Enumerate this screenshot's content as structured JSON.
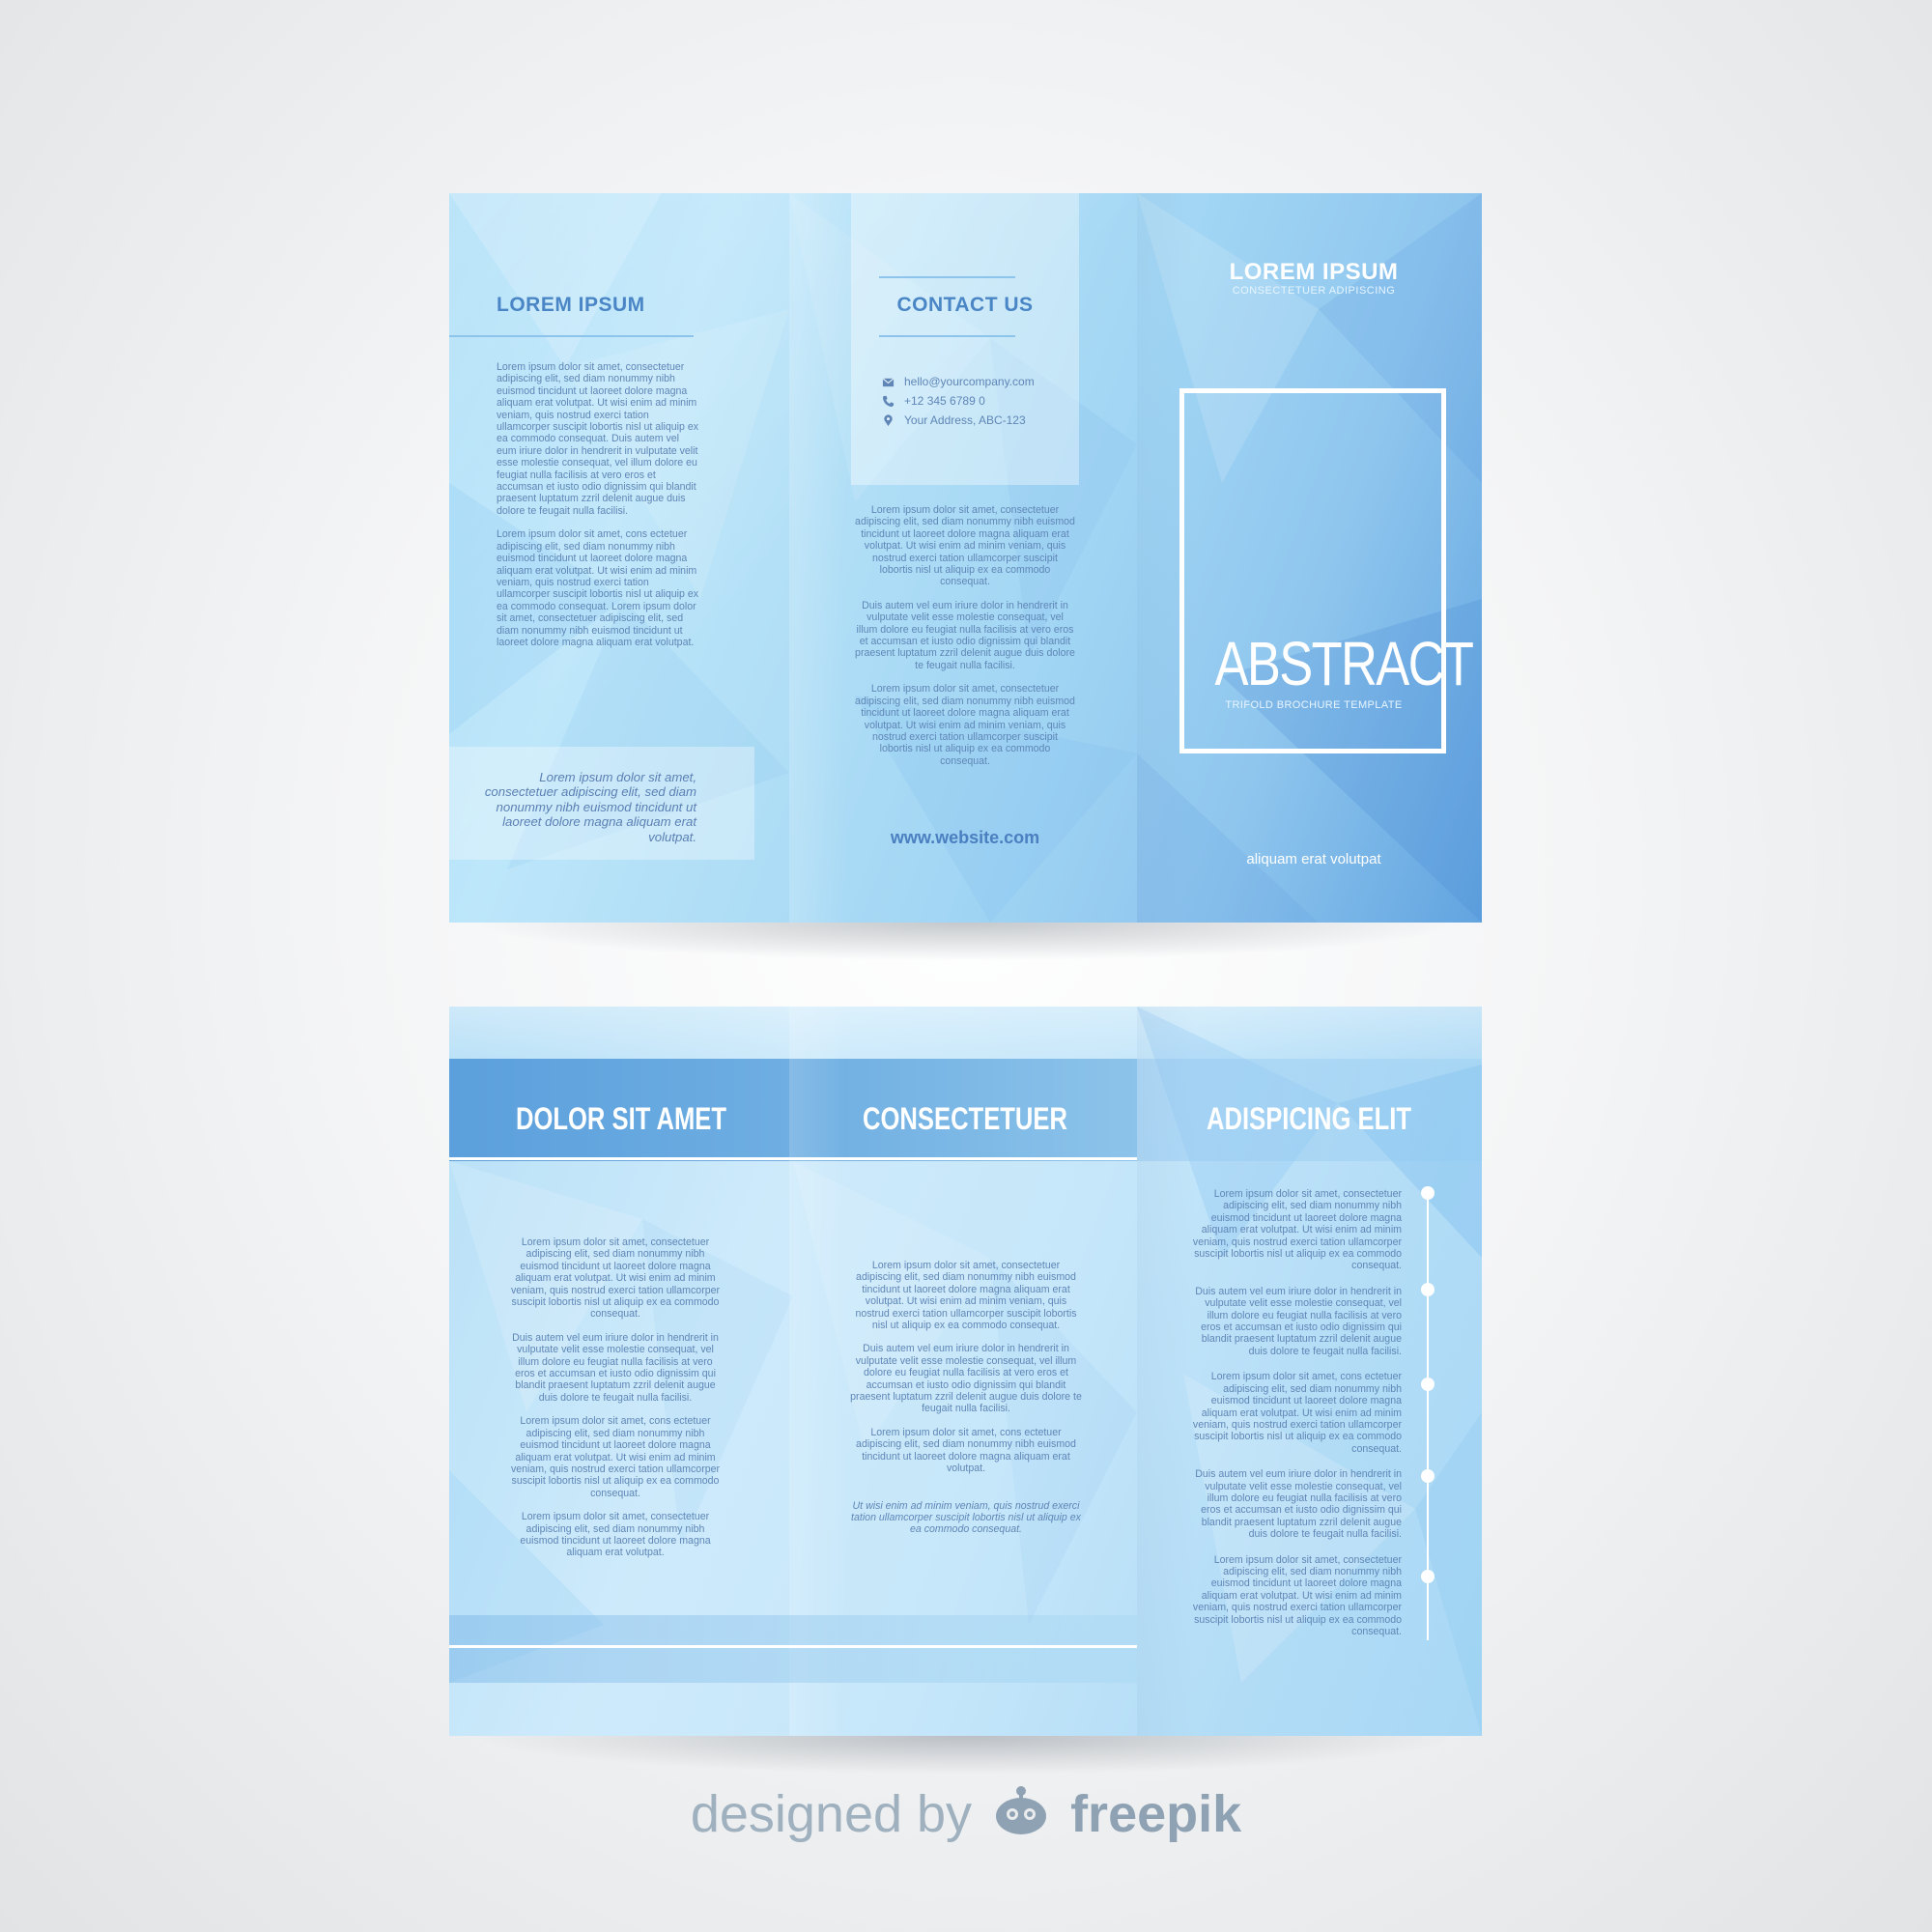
{
  "outer": {
    "left_panel": {
      "heading": "LOREM IPSUM",
      "paragraphs": [
        "Lorem ipsum dolor sit amet, consectetuer adipiscing elit, sed diam nonummy nibh euismod tincidunt ut laoreet dolore magna aliquam erat volutpat. Ut wisi enim ad minim veniam, quis nostrud exerci tation ullamcorper suscipit lobortis nisl ut aliquip ex ea commodo consequat. Duis autem vel eum iriure dolor in hendrerit in vulputate velit esse molestie consequat, vel illum dolore eu feugiat nulla facilisis at vero eros et accumsan et iusto odio dignissim qui blandit praesent luptatum zzril delenit augue duis dolore te feugait nulla facilisi.",
        "Lorem ipsum dolor sit amet, cons ectetuer adipiscing elit, sed diam nonummy nibh euismod tincidunt ut laoreet dolore magna aliquam erat volutpat. Ut wisi enim ad minim veniam, quis nostrud exerci tation ullamcorper suscipit lobortis nisl ut aliquip ex ea commodo consequat. Lorem ipsum dolor sit amet, consectetuer adipiscing elit, sed diam nonummy nibh euismod tincidunt ut laoreet dolore magna aliquam erat volutpat."
      ],
      "quote": "Lorem ipsum dolor sit amet, consectetuer adipiscing elit, sed diam nonummy nibh euismod tincidunt ut laoreet dolore magna aliquam erat volutpat."
    },
    "middle_panel": {
      "heading": "CONTACT US",
      "email": "hello@yourcompany.com",
      "phone": "+12 345 6789 0",
      "address": "Your Address, ABC-123",
      "paragraphs": [
        "Lorem ipsum dolor sit amet, consectetuer adipiscing elit, sed diam nonummy nibh euismod tincidunt ut laoreet dolore magna aliquam erat volutpat. Ut wisi enim ad minim veniam, quis nostrud exerci tation ullamcorper suscipit lobortis nisl ut aliquip ex ea commodo consequat.",
        "Duis autem vel eum iriure dolor in hendrerit in vulputate velit esse molestie consequat, vel illum dolore eu feugiat nulla facilisis at vero eros et accumsan et iusto odio dignissim qui blandit praesent luptatum zzril delenit augue duis dolore te feugait nulla facilisi.",
        "Lorem ipsum dolor sit amet, consectetuer adipiscing elit, sed diam nonummy nibh euismod tincidunt ut laoreet dolore magna aliquam erat volutpat. Ut wisi enim ad minim veniam, quis nostrud exerci tation ullamcorper suscipit lobortis nisl ut aliquip ex ea commodo consequat."
      ],
      "website": "www.website.com"
    },
    "cover_panel": {
      "title": "LOREM IPSUM",
      "subtitle": "CONSECTETUER ADIPISCING",
      "main_title": "ABSTRACT",
      "main_subtitle": "TRIFOLD BROCHURE TEMPLATE",
      "footer": "aliquam erat volutpat"
    }
  },
  "inner": {
    "headings": [
      "DOLOR SIT AMET",
      "CONSECTETUER",
      "ADISPICING ELIT"
    ],
    "col1": [
      "Lorem ipsum dolor sit amet, consectetuer adipiscing elit, sed diam nonummy nibh euismod tincidunt ut laoreet dolore magna aliquam erat volutpat. Ut wisi enim ad minim veniam, quis nostrud exerci tation ullamcorper suscipit lobortis nisl ut aliquip ex ea commodo consequat.",
      "Duis autem vel eum iriure dolor in hendrerit in vulputate velit esse molestie consequat, vel illum dolore eu feugiat nulla facilisis at vero eros et accumsan et iusto odio dignissim qui blandit praesent luptatum zzril delenit augue duis dolore te feugait nulla facilisi.",
      "Lorem ipsum dolor sit amet, cons ectetuer adipiscing elit, sed diam nonummy nibh euismod tincidunt ut laoreet dolore magna aliquam erat volutpat. Ut wisi enim ad minim veniam, quis nostrud exerci tation ullamcorper suscipit lobortis nisl ut aliquip ex ea commodo consequat.",
      "Lorem ipsum dolor sit amet, consectetuer adipiscing elit, sed diam nonummy nibh euismod tincidunt ut laoreet dolore magna aliquam erat volutpat."
    ],
    "col2": [
      "Lorem ipsum dolor sit amet, consectetuer adipiscing elit, sed diam nonummy nibh euismod tincidunt ut laoreet dolore magna aliquam erat volutpat. Ut wisi enim ad minim veniam, quis nostrud exerci tation ullamcorper suscipit lobortis nisl ut aliquip ex ea commodo consequat.",
      "Duis autem vel eum iriure dolor in hendrerit in vulputate velit esse molestie consequat, vel illum dolore eu feugiat nulla facilisis at vero eros et accumsan et iusto odio dignissim qui blandit praesent luptatum zzril delenit augue duis dolore te feugait nulla facilisi.",
      "Lorem ipsum dolor sit amet, cons ectetuer adipiscing elit, sed diam nonummy nibh euismod tincidunt ut laoreet dolore magna aliquam erat volutpat."
    ],
    "col2_italic": "Ut wisi enim ad minim veniam, quis nostrud exerci tation ullamcorper suscipit lobortis nisl ut aliquip ex ea commodo consequat.",
    "col3": [
      "Lorem ipsum dolor sit amet, consectetuer adipiscing elit, sed diam nonummy nibh euismod tincidunt ut laoreet dolore magna aliquam erat volutpat. Ut wisi enim ad minim veniam, quis nostrud exerci tation ullamcorper suscipit lobortis nisl ut aliquip ex ea commodo consequat.",
      "Duis autem vel eum iriure dolor in hendrerit in vulputate velit esse molestie consequat, vel illum dolore eu feugiat nulla facilisis at vero eros et accumsan et iusto odio dignissim qui blandit praesent luptatum zzril delenit augue duis dolore te feugait nulla facilisi.",
      "Lorem ipsum dolor sit amet, cons ectetuer adipiscing elit, sed diam nonummy nibh euismod tincidunt ut laoreet dolore magna aliquam erat volutpat. Ut wisi enim ad minim veniam, quis nostrud exerci tation ullamcorper suscipit lobortis nisl ut aliquip ex ea commodo consequat.",
      "Duis autem vel eum iriure dolor in hendrerit in vulputate velit esse molestie consequat, vel illum dolore eu feugiat nulla facilisis at vero eros et accumsan et iusto odio dignissim qui blandit praesent luptatum zzril delenit augue duis dolore te feugait nulla facilisi.",
      "Lorem ipsum dolor sit amet, consectetuer adipiscing elit, sed diam nonummy nibh euismod tincidunt ut laoreet dolore magna aliquam erat volutpat. Ut wisi enim ad minim veniam, quis nostrud exerci tation ullamcorper suscipit lobortis nisl ut aliquip ex ea commodo consequat."
    ]
  },
  "credit": {
    "prefix": "designed by",
    "brand": "freepik"
  },
  "colors": {
    "heading_blue": "#4a86c6",
    "text_blue": "#5f86b6",
    "band_blue": "#5b9fdc",
    "sheet_light": "#bde6fa"
  },
  "icons": {
    "email": "envelope-icon",
    "phone": "phone-icon",
    "address": "map-pin-icon",
    "credit_logo": "freepik-robot-icon"
  }
}
